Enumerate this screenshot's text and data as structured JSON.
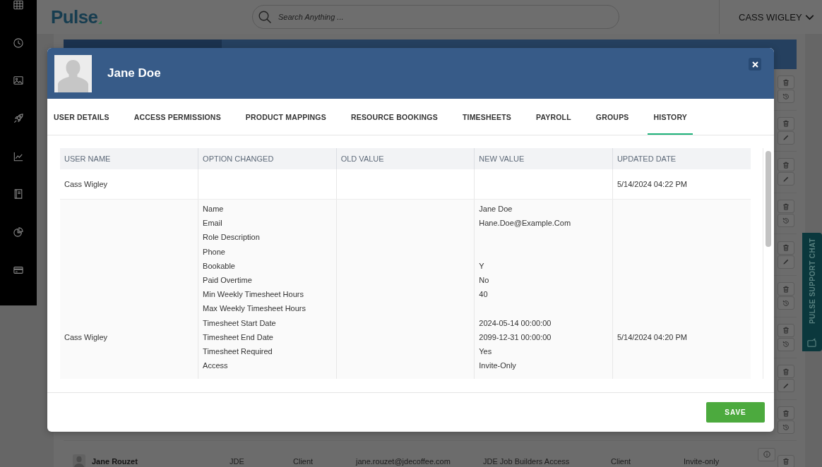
{
  "top_bar": {
    "logo": "Pulse",
    "search": {
      "placeholder": "Search Anything ..."
    },
    "user_menu": "CASS WIGLEY"
  },
  "user_list": {
    "rows": [
      {
        "cells": [
          "Jane Rouzet",
          "JDE",
          "Client",
          "jane.rouzet@jdecoffee.com",
          "JDE Job Builders Access",
          "Client",
          "Invite-only"
        ]
      }
    ]
  },
  "support_chat": {
    "label": "PULSE SUPPORT CHAT"
  },
  "modal": {
    "title": "Jane Doe",
    "tabs": [
      {
        "label": "USER DETAILS",
        "selected": false
      },
      {
        "label": "ACCESS PERMISSIONS",
        "selected": false
      },
      {
        "label": "PRODUCT MAPPINGS",
        "selected": false
      },
      {
        "label": "RESOURCE BOOKINGS",
        "selected": false
      },
      {
        "label": "TIMESHEETS",
        "selected": false
      },
      {
        "label": "PAYROLL",
        "selected": false
      },
      {
        "label": "GROUPS",
        "selected": false
      },
      {
        "label": "HISTORY",
        "selected": true
      }
    ],
    "history_table": {
      "columns": [
        "USER NAME",
        "OPTION CHANGED",
        "OLD VALUE",
        "NEW VALUE",
        "UPDATED DATE"
      ],
      "rows": [
        {
          "user_name": "Cass Wigley",
          "updated_date": "5/14/2024 04:22 PM"
        },
        {
          "user_name": "Cass Wigley",
          "updated_date": "5/14/2024 04:20 PM",
          "changes": [
            {
              "option": "Name",
              "new_value": "Jane Doe"
            },
            {
              "option": "Email",
              "new_value": "Hane.Doe@Example.Com"
            },
            {
              "option": "Role Description"
            },
            {
              "option": "Phone"
            },
            {
              "option": "Bookable",
              "new_value": "Y"
            },
            {
              "option": "Paid Overtime",
              "new_value": "No"
            },
            {
              "option": "Min Weekly Timesheet Hours",
              "new_value": "40"
            },
            {
              "option": "Max Weekly Timesheet Hours"
            },
            {
              "option": "Timesheet Start Date",
              "new_value": "2024-05-14 00:00:00"
            },
            {
              "option": "Timesheet End Date",
              "new_value": "2099-12-31 00:00:00"
            },
            {
              "option": "Timesheet Required",
              "new_value": "Yes"
            },
            {
              "option": "Access",
              "new_value": "Invite-Only"
            }
          ]
        }
      ]
    },
    "buttons": [
      {
        "label": "SAVE"
      }
    ]
  }
}
